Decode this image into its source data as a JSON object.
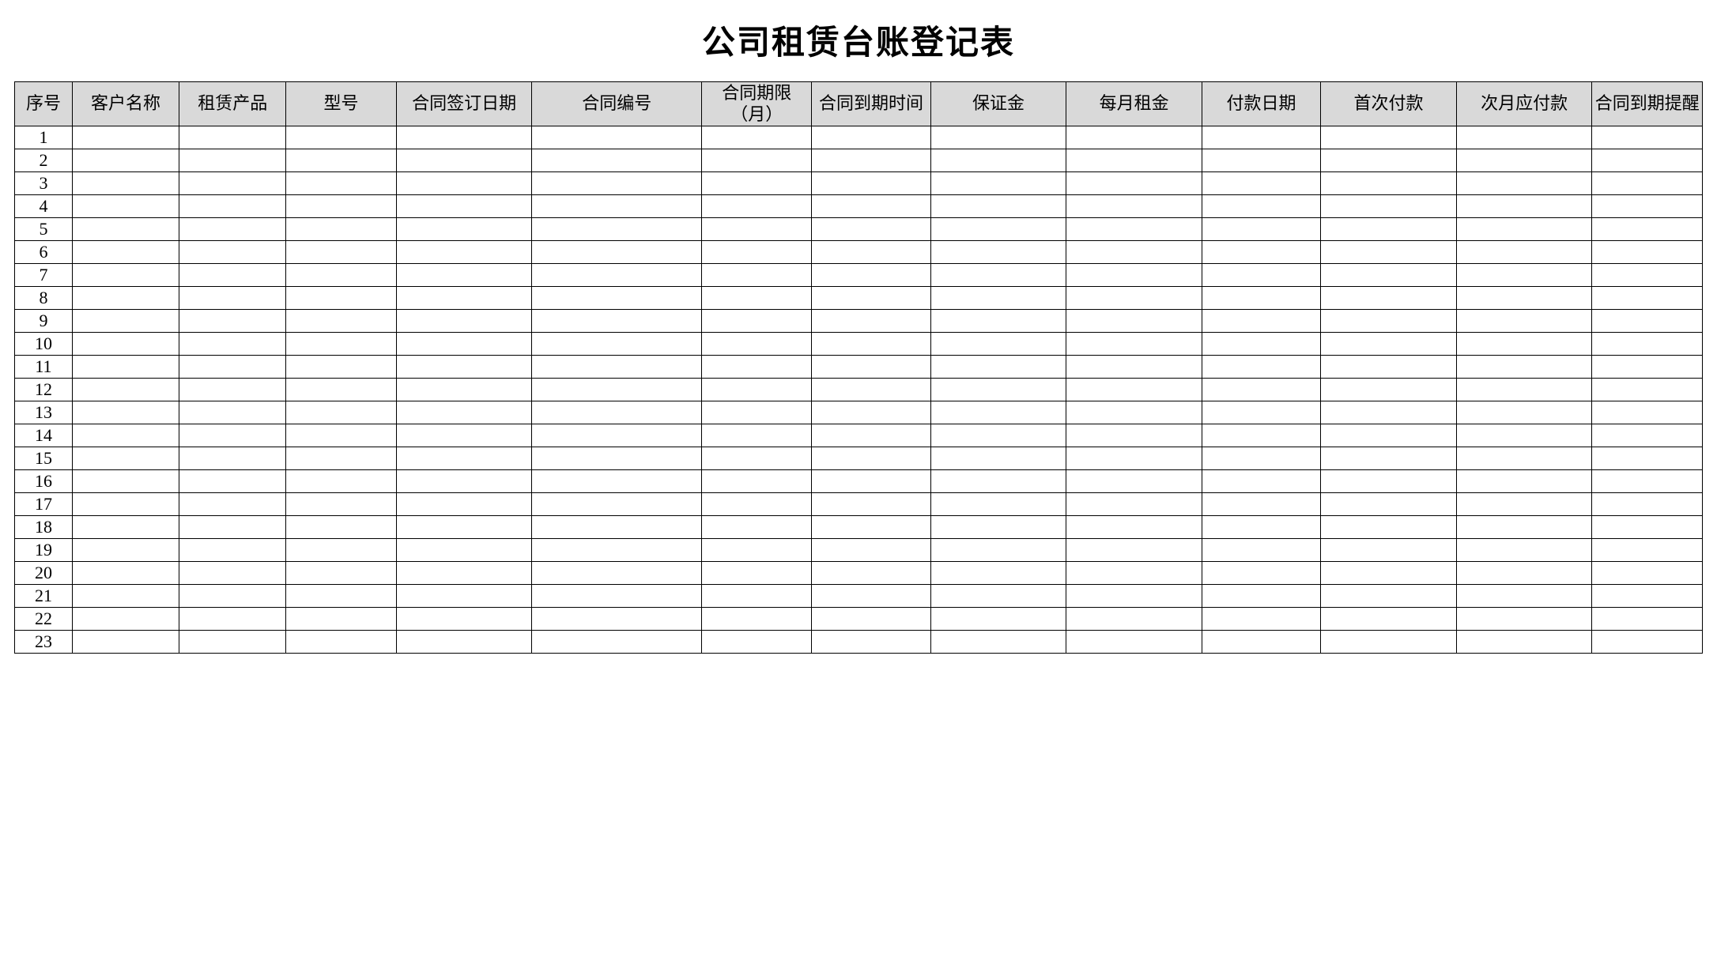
{
  "title": "公司租赁台账登记表",
  "columns": [
    "序号",
    "客户名称",
    "租赁产品",
    "型号",
    "合同签订日期",
    "合同编号",
    "合同期限（月）",
    "合同到期时间",
    "保证金",
    "每月租金",
    "付款日期",
    "首次付款",
    "次月应付款",
    "合同到期提醒"
  ],
  "rows": [
    {
      "seq": "1"
    },
    {
      "seq": "2"
    },
    {
      "seq": "3"
    },
    {
      "seq": "4"
    },
    {
      "seq": "5"
    },
    {
      "seq": "6"
    },
    {
      "seq": "7"
    },
    {
      "seq": "8"
    },
    {
      "seq": "9"
    },
    {
      "seq": "10"
    },
    {
      "seq": "11"
    },
    {
      "seq": "12"
    },
    {
      "seq": "13"
    },
    {
      "seq": "14"
    },
    {
      "seq": "15"
    },
    {
      "seq": "16"
    },
    {
      "seq": "17"
    },
    {
      "seq": "18"
    },
    {
      "seq": "19"
    },
    {
      "seq": "20"
    },
    {
      "seq": "21"
    },
    {
      "seq": "22"
    },
    {
      "seq": "23"
    }
  ]
}
